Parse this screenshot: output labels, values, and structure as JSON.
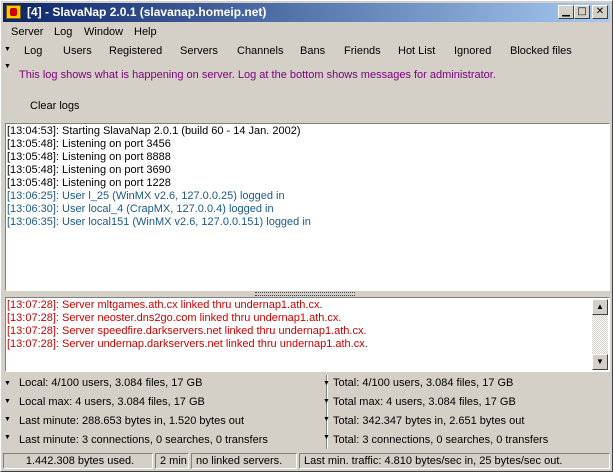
{
  "window": {
    "title": "[4] - SlavaNap 2.0.1 (slavanap.homeip.net)"
  },
  "menu": [
    "Server",
    "Log",
    "Window",
    "Help"
  ],
  "tabs": [
    "Log",
    "Users",
    "Registered",
    "Servers",
    "Channels",
    "Bans",
    "Friends",
    "Hot List",
    "Ignored",
    "Blocked files"
  ],
  "info_text": "This log shows what is happening on server. Log at the bottom shows messages for administrator.",
  "clear_label": "Clear logs",
  "server_log": [
    {
      "text": "[13:04:53]: Starting SlavaNap 2.0.1 (build 60 - 14 Jan. 2002)",
      "color": "black"
    },
    {
      "text": "[13:05:48]: Listening on port 3456",
      "color": "black"
    },
    {
      "text": "[13:05:48]: Listening on port 8888",
      "color": "black"
    },
    {
      "text": "[13:05:48]: Listening on port 3690",
      "color": "black"
    },
    {
      "text": "[13:05:48]: Listening on port 1228",
      "color": "black"
    },
    {
      "text": "[13:06:25]: User l_25 (WinMX v2.6, 127.0.0.25) logged in",
      "color": "teal"
    },
    {
      "text": "[13:06:30]: User local_4 (CrapMX, 127.0.0.4) logged in",
      "color": "teal"
    },
    {
      "text": "[13:06:35]: User local151 (WinMX v2.6, 127.0.0.151) logged in",
      "color": "teal"
    }
  ],
  "admin_log": [
    {
      "text": "[13:07:28]: Server mltgames.ath.cx linked thru undernap1.ath.cx.",
      "color": "red"
    },
    {
      "text": "[13:07:28]: Server neoster.dns2go.com linked thru undernap1.ath.cx.",
      "color": "red"
    },
    {
      "text": "[13:07:28]: Server speedfire.darkservers.net linked thru undernap1.ath.cx.",
      "color": "red"
    },
    {
      "text": "[13:07:28]: Server undernap.darkservers.net linked thru undernap1.ath.cx.",
      "color": "red"
    }
  ],
  "stats": {
    "left": [
      "Local: 4/100 users, 3.084 files, 17 GB",
      "Local max: 4 users, 3.084 files, 17 GB",
      "Last minute: 288.653 bytes in, 1.520 bytes out",
      "Last minute: 3 connections, 0 searches, 0 transfers"
    ],
    "right": [
      "Total: 4/100 users, 3.084 files, 17 GB",
      "Total max: 4 users, 3.084 files, 17 GB",
      "Total: 342.347 bytes in, 2.651 bytes out",
      "Total: 3 connections, 0 searches, 0 transfers"
    ]
  },
  "status": [
    "1.442.308 bytes used.",
    "2 min.",
    "no linked servers.",
    "Last min. traffic: 4.810 bytes/sec in, 25 bytes/sec out."
  ],
  "colors": {
    "black": "#000000",
    "teal": "#1a5a8a",
    "red": "#cc0000",
    "info": "#800080",
    "title_start": "#0a246a"
  },
  "icons": {
    "minimize": "minimize-icon",
    "maximize": "maximize-icon",
    "close": "close-icon"
  }
}
